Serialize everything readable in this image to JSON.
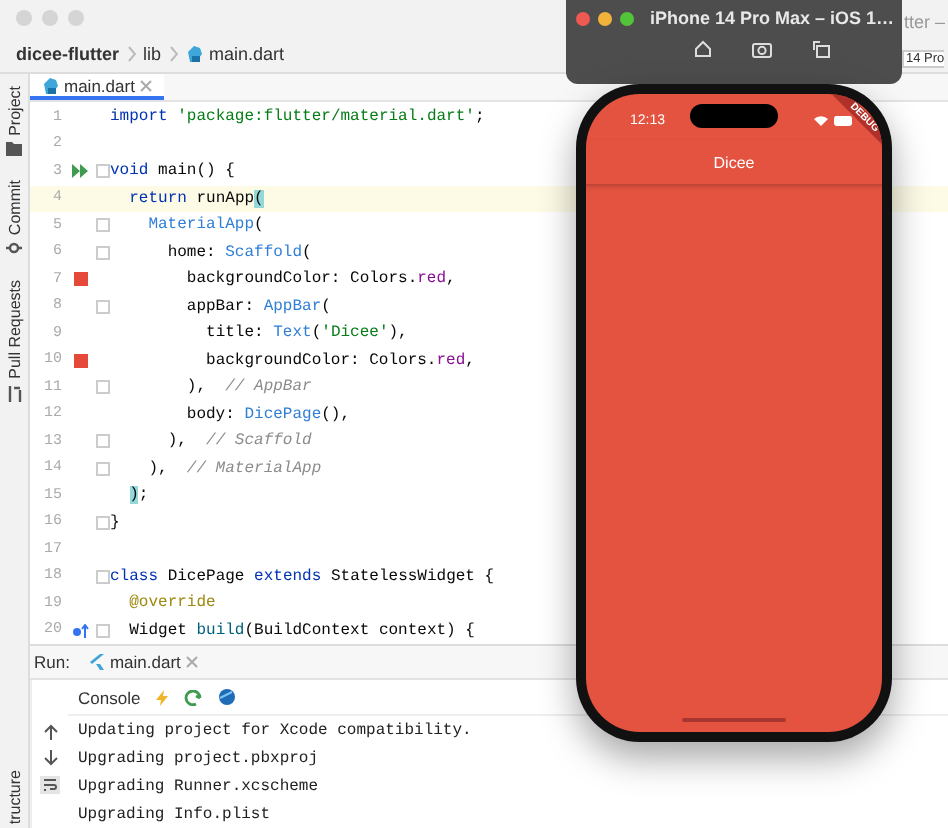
{
  "breadcrumb": [
    "dicee-flutter",
    "lib",
    "main.dart"
  ],
  "behind_toolbar": {
    "title_fragment": "tter –",
    "device_fragment": "14 Pro"
  },
  "side_tabs": [
    {
      "label": "Project"
    },
    {
      "label": "Commit"
    },
    {
      "label": "Pull Requests"
    }
  ],
  "bottom_side_tab": "tructure",
  "editor_tab": {
    "label": "main.dart",
    "selected": true
  },
  "code_lines": [
    {
      "number": "1",
      "tokens": [
        {
          "kind": "keyword",
          "text": "import"
        },
        {
          "kind": "string",
          "text": " 'package:flutter/material.dart'"
        },
        {
          "kind": "plain",
          "text": ";"
        }
      ]
    },
    {
      "number": "2"
    },
    {
      "number": "3",
      "kind": "run",
      "fold": true,
      "tokens": [
        {
          "kind": "keyword",
          "text": "void"
        },
        {
          "kind": "plain",
          "text": " main() {"
        }
      ]
    },
    {
      "number": "4",
      "current": true,
      "tokens": [
        {
          "kind": "keyword",
          "text": "  return"
        },
        {
          "kind": "plain",
          "text": " runApp"
        },
        {
          "kind": "match",
          "text": "("
        }
      ]
    },
    {
      "number": "5",
      "fold": true,
      "tokens": [
        {
          "kind": "class",
          "text": "    MaterialApp"
        },
        {
          "kind": "plain",
          "text": "("
        }
      ]
    },
    {
      "number": "6",
      "fold": true,
      "tokens": [
        {
          "kind": "plain",
          "text": "      home: "
        },
        {
          "kind": "class",
          "text": "Scaffold"
        },
        {
          "kind": "plain",
          "text": "("
        }
      ]
    },
    {
      "number": "7",
      "kind": "color",
      "color": "#e5493a",
      "tokens": [
        {
          "kind": "plain",
          "text": "        backgroundColor: Colors."
        },
        {
          "kind": "field",
          "text": "red"
        },
        {
          "kind": "plain",
          "text": ","
        }
      ]
    },
    {
      "number": "8",
      "fold": true,
      "tokens": [
        {
          "kind": "plain",
          "text": "        appBar: "
        },
        {
          "kind": "class",
          "text": "AppBar"
        },
        {
          "kind": "plain",
          "text": "("
        }
      ]
    },
    {
      "number": "9",
      "tokens": [
        {
          "kind": "plain",
          "text": "          title: "
        },
        {
          "kind": "class",
          "text": "Text"
        },
        {
          "kind": "plain",
          "text": "("
        },
        {
          "kind": "string",
          "text": "'Dicee'"
        },
        {
          "kind": "plain",
          "text": "),"
        }
      ]
    },
    {
      "number": "10",
      "kind": "color",
      "color": "#e5493a",
      "tokens": [
        {
          "kind": "plain",
          "text": "          backgroundColor: Colors."
        },
        {
          "kind": "field",
          "text": "red"
        },
        {
          "kind": "plain",
          "text": ","
        }
      ]
    },
    {
      "number": "11",
      "fold": true,
      "tokens": [
        {
          "kind": "plain",
          "text": "        ),  "
        },
        {
          "kind": "comment",
          "text": "// AppBar"
        }
      ]
    },
    {
      "number": "12",
      "tokens": [
        {
          "kind": "plain",
          "text": "        body: "
        },
        {
          "kind": "class",
          "text": "DicePage"
        },
        {
          "kind": "plain",
          "text": "(),"
        }
      ]
    },
    {
      "number": "13",
      "fold": true,
      "tokens": [
        {
          "kind": "plain",
          "text": "      ),  "
        },
        {
          "kind": "comment",
          "text": "// Scaffold"
        }
      ]
    },
    {
      "number": "14",
      "fold": true,
      "tokens": [
        {
          "kind": "plain",
          "text": "    ),  "
        },
        {
          "kind": "comment",
          "text": "// MaterialApp"
        }
      ]
    },
    {
      "number": "15",
      "tokens": [
        {
          "kind": "match",
          "text": "  )"
        },
        {
          "kind": "plain",
          "text": ";"
        }
      ]
    },
    {
      "number": "16",
      "fold": true,
      "tokens": [
        {
          "kind": "plain",
          "text": "}"
        }
      ]
    },
    {
      "number": "17"
    },
    {
      "number": "18",
      "fold": true,
      "tokens": [
        {
          "kind": "keyword",
          "text": "class"
        },
        {
          "kind": "plain",
          "text": " DicePage "
        },
        {
          "kind": "keyword",
          "text": "extends"
        },
        {
          "kind": "plain",
          "text": " StatelessWidget {"
        }
      ]
    },
    {
      "number": "19",
      "tokens": [
        {
          "kind": "annotation",
          "text": "  @override"
        }
      ]
    },
    {
      "number": "20",
      "kind": "override",
      "fold": true,
      "tokens": [
        {
          "kind": "plain",
          "text": "  Widget "
        },
        {
          "kind": "function",
          "text": "build"
        },
        {
          "kind": "plain",
          "text": "(BuildContext context) {"
        }
      ]
    }
  ],
  "run_panel": {
    "label": "Run:",
    "tab": "main.dart",
    "console_tab": "Console",
    "output": [
      "Updating project for Xcode compatibility.",
      "Upgrading project.pbxproj",
      "Upgrading Runner.xcscheme",
      "Upgrading Info.plist"
    ]
  },
  "simulator": {
    "title": "iPhone 14 Pro Max – iOS 1…",
    "time": "12:13",
    "app_title": "Dicee",
    "banner": "DEBUG"
  }
}
